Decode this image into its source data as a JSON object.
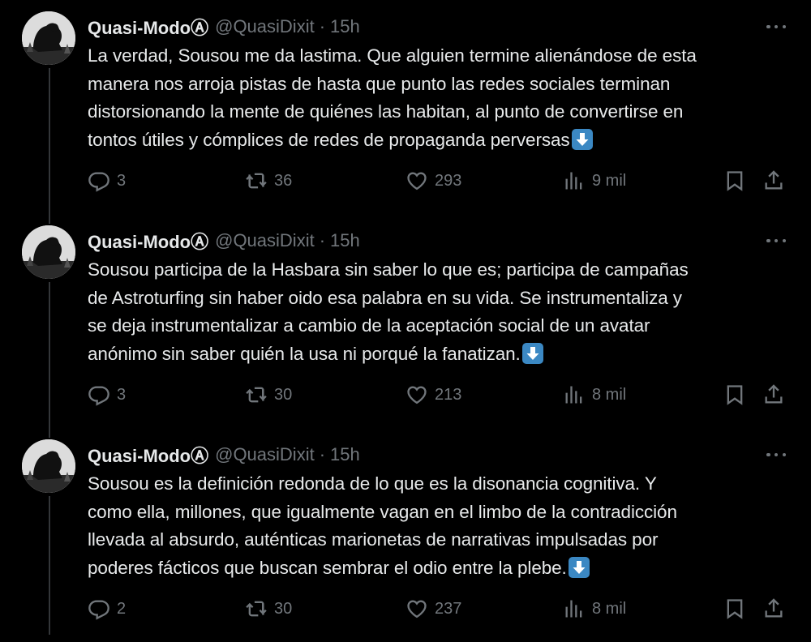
{
  "colors": {
    "background": "#000000",
    "text_primary": "#e7e9ea",
    "text_secondary": "#71767b",
    "emoji_blue": "#3b88c3"
  },
  "tweets": [
    {
      "author_name": "Quasi-ModoⒶ",
      "handle": "@QuasiDixit",
      "separator": "·",
      "time": "15h",
      "lines": [
        "La verdad, Sousou me da lastima. Que alguien termine alienándose de esta",
        "manera nos arroja pistas de hasta que punto las redes sociales terminan",
        "distorsionando la mente de quiénes las habitan, al punto de convertirse en",
        "tontos útiles y cómplices de redes de propaganda perversas"
      ],
      "emoji": "down-arrow-emoji",
      "replies": "3",
      "retweets": "36",
      "likes": "293",
      "views": "9 mil"
    },
    {
      "author_name": "Quasi-ModoⒶ",
      "handle": "@QuasiDixit",
      "separator": "·",
      "time": "15h",
      "lines": [
        "Sousou participa de la Hasbara sin saber lo que es; participa de campañas",
        "de Astroturfing sin haber oido esa palabra en su vida. Se instrumentaliza y",
        "se deja instrumentalizar a cambio de la aceptación social de un avatar",
        "anónimo sin saber quién la usa ni porqué la fanatizan."
      ],
      "emoji": "down-arrow-emoji",
      "replies": "3",
      "retweets": "30",
      "likes": "213",
      "views": "8 mil"
    },
    {
      "author_name": "Quasi-ModoⒶ",
      "handle": "@QuasiDixit",
      "separator": "·",
      "time": "15h",
      "lines": [
        "Sousou es la definición redonda de lo que es la disonancia cognitiva. Y",
        "como ella, millones, que igualmente vagan en el limbo de la contradicción",
        "llevada al absurdo, auténticas marionetas de narrativas impulsadas por",
        "poderes fácticos que buscan sembrar el odio entre la plebe."
      ],
      "emoji": "down-arrow-emoji",
      "replies": "2",
      "retweets": "30",
      "likes": "237",
      "views": "8 mil"
    }
  ],
  "icons": {
    "reply": "reply-icon",
    "retweet": "retweet-icon",
    "like": "heart-icon",
    "views": "views-chart-icon",
    "bookmark": "bookmark-icon",
    "share": "share-icon",
    "more": "more-options-icon"
  }
}
